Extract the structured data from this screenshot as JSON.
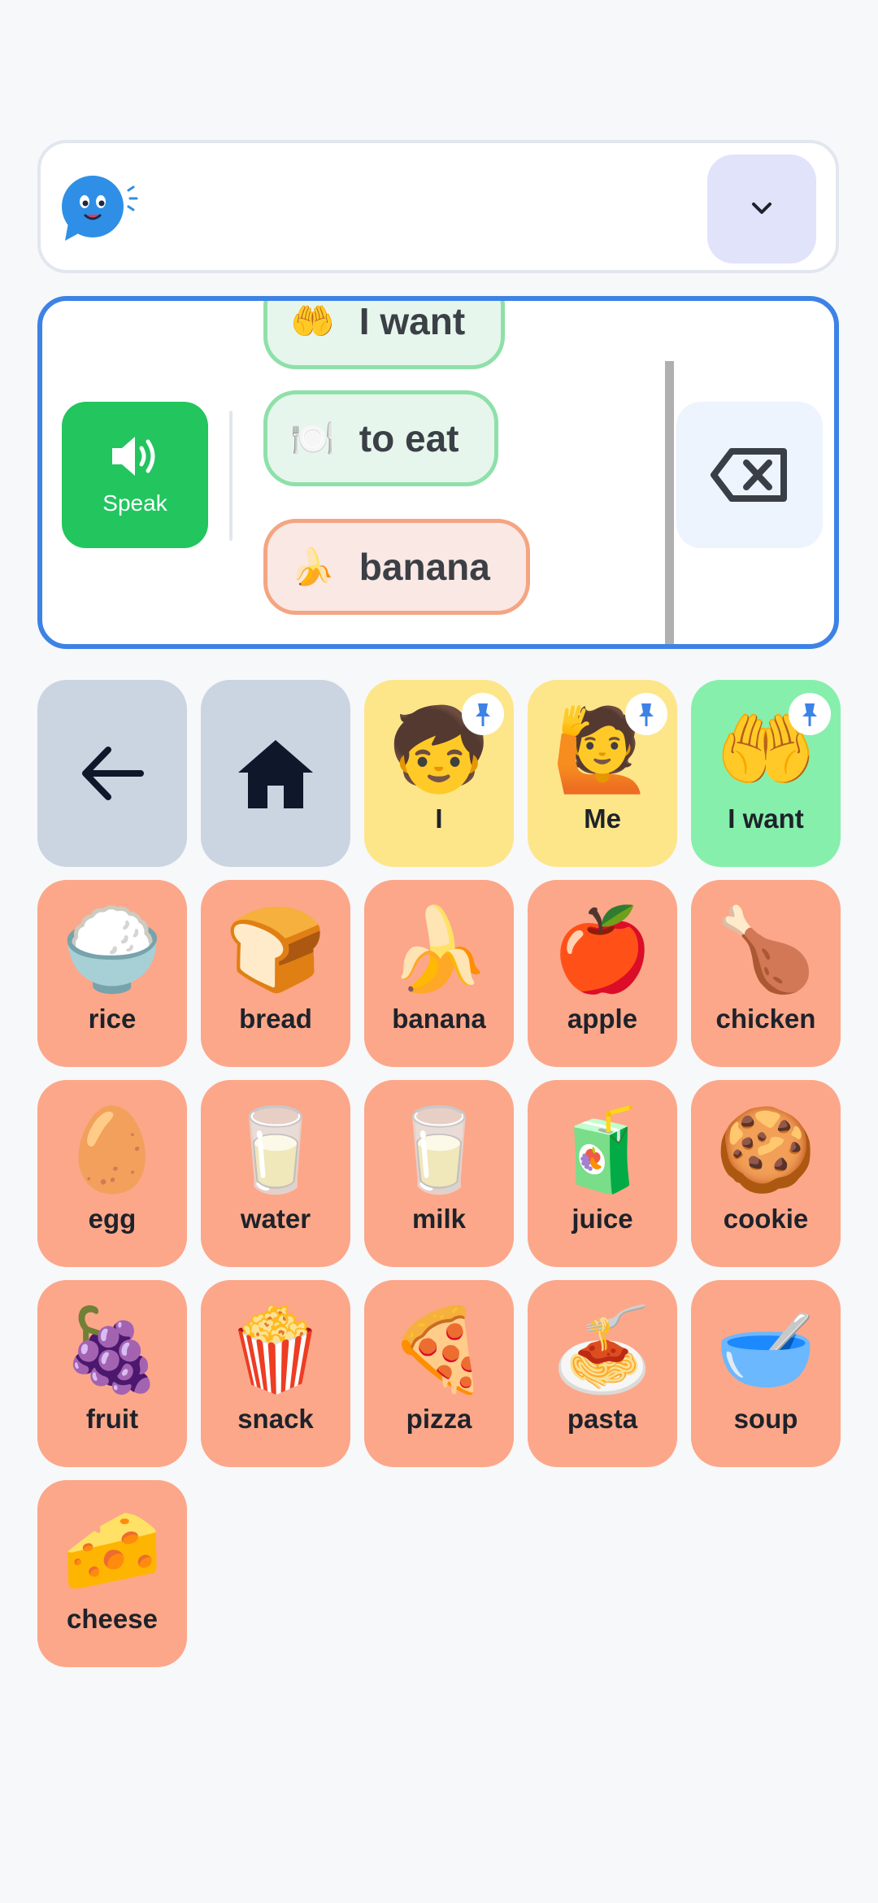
{
  "header": {
    "logo_icon": "speech-bubble-logo-icon",
    "dropdown_icon": "chevron-down-icon"
  },
  "sentence": {
    "speak_label": "Speak",
    "chips": [
      {
        "emoji": "🤲",
        "label": "I want",
        "color": "green"
      },
      {
        "emoji": "🍽️",
        "label": "to eat",
        "color": "green"
      },
      {
        "emoji": "🍌",
        "label": "banana",
        "color": "orange"
      }
    ]
  },
  "nav_tiles": [
    {
      "name": "back-button",
      "icon": "arrow-left-icon"
    },
    {
      "name": "home-button",
      "icon": "home-icon"
    }
  ],
  "pinned_tiles": [
    {
      "emoji": "🧒",
      "label": "I",
      "color": "yellow",
      "pinned": true
    },
    {
      "emoji": "🙋",
      "label": "Me",
      "color": "yellow",
      "pinned": true
    },
    {
      "emoji": "🤲",
      "label": "I want",
      "color": "green",
      "pinned": true
    }
  ],
  "food_tiles": [
    {
      "emoji": "🍚",
      "label": "rice"
    },
    {
      "emoji": "🍞",
      "label": "bread"
    },
    {
      "emoji": "🍌",
      "label": "banana"
    },
    {
      "emoji": "🍎",
      "label": "apple"
    },
    {
      "emoji": "🍗",
      "label": "chicken"
    },
    {
      "emoji": "🥚",
      "label": "egg"
    },
    {
      "emoji": "🥛",
      "label": "water"
    },
    {
      "emoji": "🥛",
      "label": "milk"
    },
    {
      "emoji": "🧃",
      "label": "juice"
    },
    {
      "emoji": "🍪",
      "label": "cookie"
    },
    {
      "emoji": "🍇",
      "label": "fruit"
    },
    {
      "emoji": "🍿",
      "label": "snack"
    },
    {
      "emoji": "🍕",
      "label": "pizza"
    },
    {
      "emoji": "🍝",
      "label": "pasta"
    },
    {
      "emoji": "🥣",
      "label": "soup"
    },
    {
      "emoji": "🧀",
      "label": "cheese"
    }
  ],
  "colors": {
    "accent": "#3d82e5",
    "speak": "#22c55e",
    "food": "#fca789",
    "core": "#fde68a",
    "want": "#86efac",
    "nav": "#cbd5e1"
  }
}
